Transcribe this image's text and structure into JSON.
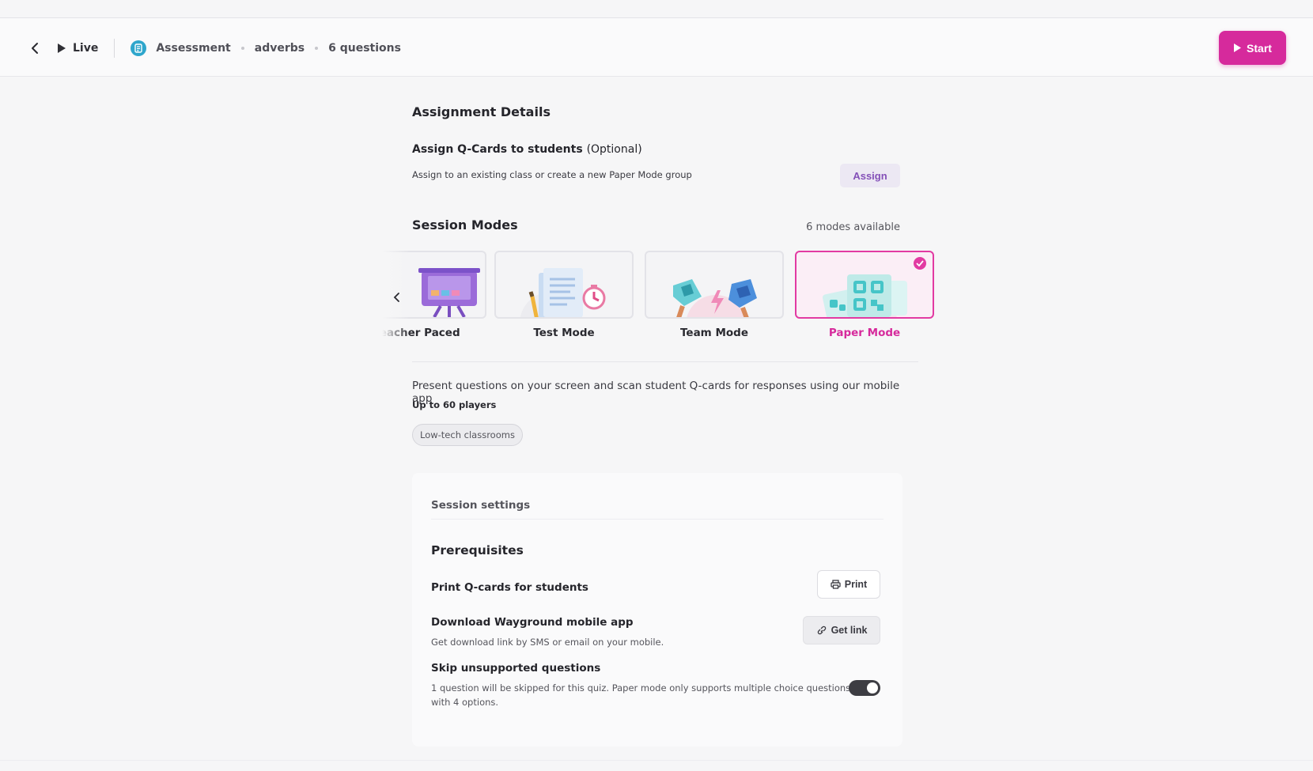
{
  "topbar": {
    "live_label": "Live",
    "breadcrumb": [
      "Assessment",
      "adverbs",
      "6 questions"
    ],
    "start_label": "Start"
  },
  "assignment": {
    "heading": "Assignment Details",
    "qcards_title": "Assign Q-Cards to students",
    "qcards_optional": "(Optional)",
    "qcards_desc": "Assign to an existing class or create a new Paper Mode group",
    "assign_label": "Assign"
  },
  "session_modes": {
    "heading": "Session Modes",
    "available": "6 modes available",
    "modes": [
      {
        "label": "Teacher Paced",
        "selected": false
      },
      {
        "label": "Test Mode",
        "selected": false
      },
      {
        "label": "Team Mode",
        "selected": false
      },
      {
        "label": "Paper Mode",
        "selected": true
      }
    ],
    "description": "Present questions on your screen and scan student Q-cards for responses using our mobile app",
    "players": "Up to 60 players",
    "tag": "Low-tech classrooms"
  },
  "settings": {
    "title": "Session settings",
    "prereq_heading": "Prerequisites",
    "print_title": "Print Q-cards for students",
    "print_label": "Print",
    "download_title": "Download Wayground mobile app",
    "download_desc": "Get download link by SMS or email on your mobile.",
    "getlink_label": "Get link",
    "skip_title": "Skip unsupported questions",
    "skip_desc_1": "1 question will be skipped for this quiz. Paper mode only supports multiple choice questions",
    "skip_desc_2": "with 4 options.",
    "skip_enabled": true
  },
  "colors": {
    "accent": "#d62a9c",
    "assign_bg": "#ece8f3",
    "assign_text": "#8450b8"
  }
}
